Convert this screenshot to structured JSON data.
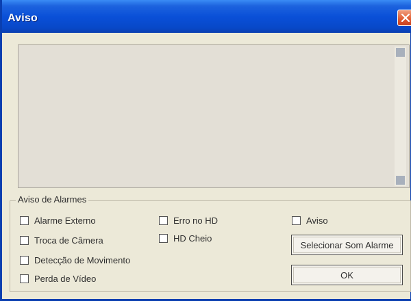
{
  "window": {
    "title": "Aviso"
  },
  "group": {
    "legend": "Aviso de Alarmes",
    "checkboxes": [
      {
        "label": "Alarme Externo",
        "checked": false
      },
      {
        "label": "Troca de Câmera",
        "checked": false
      },
      {
        "label": "Detecção de Movimento",
        "checked": false
      },
      {
        "label": "Perda de Vídeo",
        "checked": false
      },
      {
        "label": "Erro no HD",
        "checked": false
      },
      {
        "label": "HD Cheio",
        "checked": false
      },
      {
        "label": "Aviso",
        "checked": false
      }
    ]
  },
  "buttons": {
    "select_sound": "Selecionar Som Alarme",
    "ok": "OK"
  },
  "icons": {
    "close": "close-icon"
  },
  "colors": {
    "titlebar": "#0a50d8",
    "close": "#e05a30",
    "window_bg": "#ece9d8"
  }
}
